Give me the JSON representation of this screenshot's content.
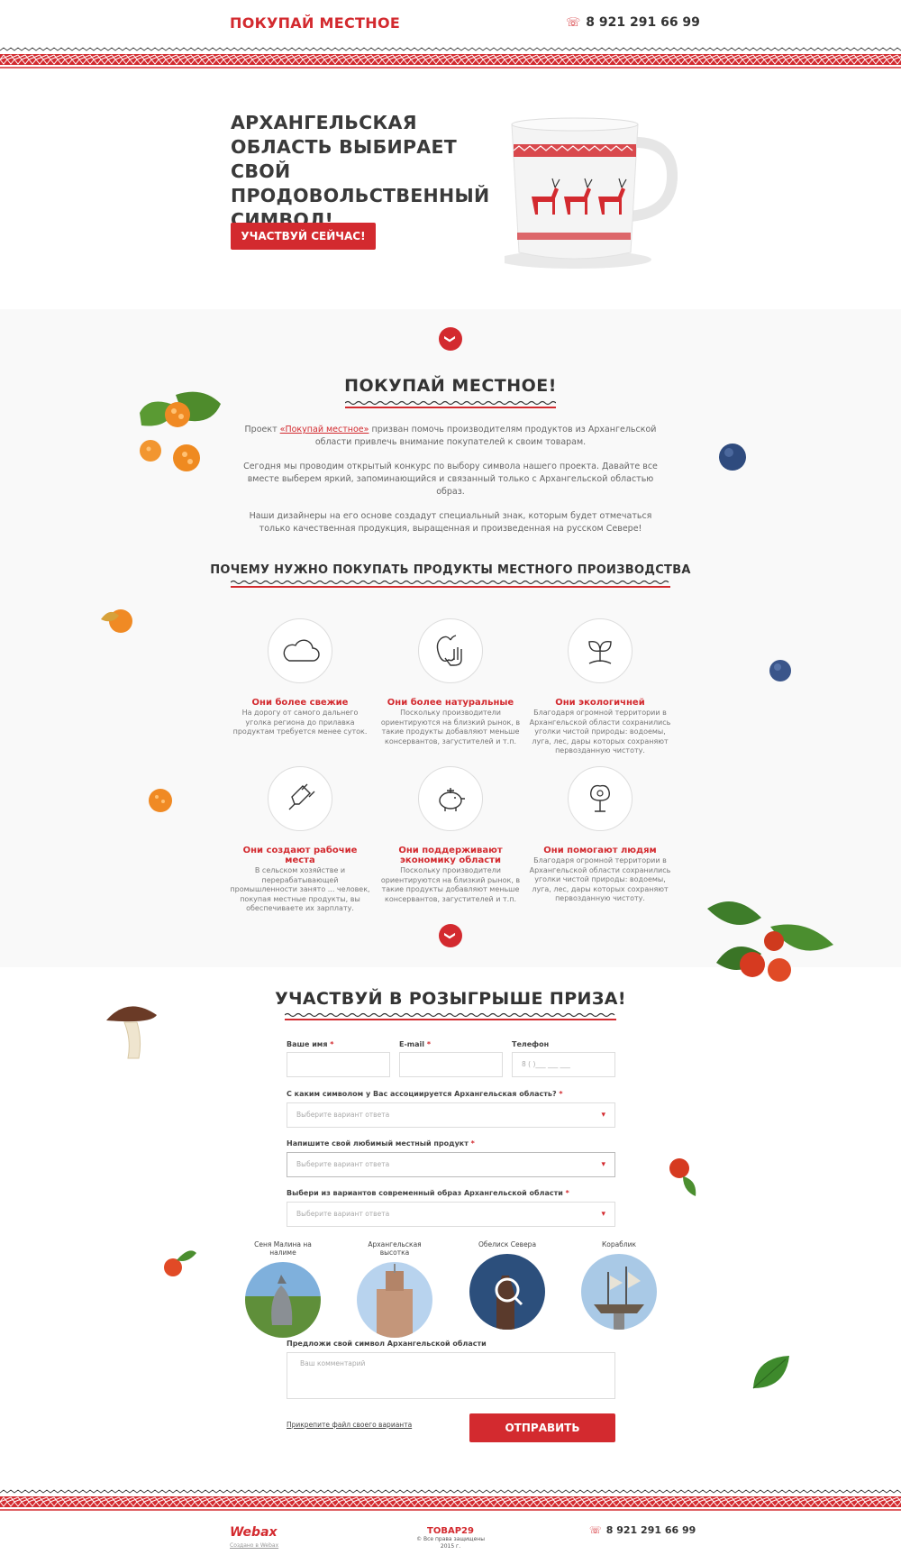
{
  "header": {
    "logo": "ПОКУПАЙ МЕСТНОЕ",
    "phone": "8 921 291 66 99"
  },
  "hero": {
    "title": "АРХАНГЕЛЬСКАЯ ОБЛАСТЬ ВЫБИРАЕТ СВОЙ ПРОДОВОЛЬСТВЕННЫЙ СИМВОЛ!",
    "cta": "УЧАСТВУЙ СЕЙЧАС!"
  },
  "about": {
    "title": "ПОКУПАЙ МЕСТНОЕ!",
    "p1_pre": "Проект ",
    "p1_link": "«Покупай местное»",
    "p1_post": " призван помочь производителям продуктов из Архангельской области привлечь внимание покупателей к своим товарам.",
    "p2": "Сегодня мы проводим открытый конкурс по выбору символа нашего проекта. Давайте все вместе выберем яркий, запоминающийся и связанный только с Архангельской областью образ.",
    "p3": "Наши дизайнеры на его основе создадут специальный знак, которым будет отмечаться только качественная продукция, выращенная и произведенная на русском Севере!"
  },
  "why": {
    "title": "ПОЧЕМУ НУЖНО ПОКУПАТЬ ПРОДУКТЫ МЕСТНОГО ПРОИЗВОДСТВА",
    "features": [
      {
        "icon": "cloud-icon",
        "title": "Они более свежие",
        "text": "На дорогу от самого дальнего уголка региона до прилавка продуктам требуется менее суток."
      },
      {
        "icon": "apple-hand-icon",
        "title": "Они более натуральные",
        "text": "Поскольку производители ориентируются на близкий рынок, в такие продукты добавляют меньше консервантов, загустителей и т.п."
      },
      {
        "icon": "sprout-icon",
        "title": "Они экологичней",
        "text": "Благодаря огромной территории в Архангельской области сохранились уголки чистой природы: водоемы, луга, лес, дары которых сохраняют первозданную чистоту."
      },
      {
        "icon": "plug-icon",
        "title": "Они создают рабочие места",
        "text": "В сельском хозяйстве и перерабатывающей промышленности занято ... человек, покупая местные продукты, вы обеспечиваете их зарплату."
      },
      {
        "icon": "piggy-bank-icon",
        "title": "Они поддерживают экономику области",
        "text": "Поскольку производители ориентируются на близкий рынок, в такие продукты добавляют меньше консервантов, загустителей и т.п."
      },
      {
        "icon": "tree-people-icon",
        "title": "Они помогают людям",
        "text": "Благодаря огромной территории в Архангельской области сохранились уголки чистой природы: водоемы, луга, лес, дары которых сохраняют первозданную чистоту."
      }
    ]
  },
  "form": {
    "title": "УЧАСТВУЙ В РОЗЫГРЫШЕ ПРИЗА!",
    "name_label": "Ваше имя",
    "email_label": "E-mail",
    "phone_label": "Телефон",
    "phone_placeholder": "8 (     )___  ___  ___",
    "q1_label": "С каким символом у Вас ассоциируется Архангельская область?",
    "q2_label": "Напишите свой любимый местный продукт",
    "q3_label": "Выбери из вариантов современный образ Архангельской области",
    "select_placeholder": "Выберите вариант ответа",
    "req": "*",
    "options": [
      {
        "label": "Сеня Малина на налиме"
      },
      {
        "label": "Архангельская высотка"
      },
      {
        "label": "Обелиск Севера"
      },
      {
        "label": "Кораблик"
      }
    ],
    "suggest_label": "Предложи свой символ Архангельской области",
    "comment_placeholder": "Ваш комментарий",
    "attach": "Прикрепите файл своего варианта",
    "submit": "ОТПРАВИТЬ"
  },
  "footer": {
    "brand": "Webax",
    "brand_sub": "Создано в Webax",
    "center_title": "ТОВАР29",
    "center_line1": "© Все права защищены",
    "center_line2": "2015 г.",
    "phone": "8 921 291 66 99"
  },
  "colors": {
    "accent": "#d32a2f",
    "text": "#333333",
    "grey_bg": "#f9f9f9"
  }
}
